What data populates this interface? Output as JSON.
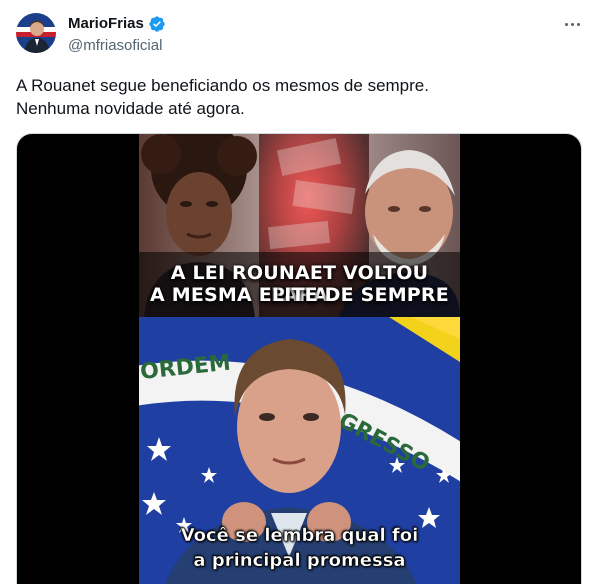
{
  "author": {
    "display_name": "MarioFrias",
    "handle": "@mfriasoficial",
    "verified": true,
    "verified_color": "#1d9bf0"
  },
  "tweet": {
    "text_lines": [
      "A Rouanet segue beneficiando os mesmos de sempre.",
      "Nenhuma novidade até agora."
    ]
  },
  "media": {
    "headline_lines": [
      "A LEI ROUNAET VOLTOU PARA",
      "A MESMA ELITE DE SEMPRE"
    ],
    "caption_lines": [
      "Você se lembra qual foi",
      "a principal promessa"
    ],
    "flag_text_1": "ORDEM",
    "flag_text_2": "GRESSO"
  },
  "icons": {
    "more": "more-icon",
    "verified": "verified-badge-icon"
  }
}
